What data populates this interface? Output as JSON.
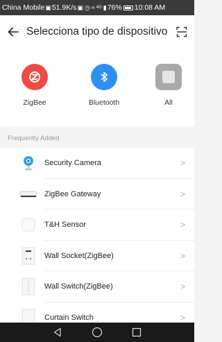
{
  "status_bar": {
    "carrier": "China Mobile",
    "net_speed": "51.9K/s",
    "signal": "4G",
    "battery": "76%",
    "time": "10:08 AM"
  },
  "header": {
    "title": "Selecciona tipo de dispositivo"
  },
  "categories": [
    {
      "label": "ZigBee",
      "color": "#ef4a44",
      "icon": "zigbee-icon"
    },
    {
      "label": "Bluetooth",
      "color": "#2e8ff0",
      "icon": "bluetooth-icon"
    },
    {
      "label": "All",
      "color": "#a9a9a9",
      "icon": "all-devices-icon"
    }
  ],
  "section": {
    "label": "Frequently Added"
  },
  "devices": [
    {
      "label": "Security Camera",
      "icon": "camera-icon"
    },
    {
      "label": "ZigBee Gateway",
      "icon": "gateway-icon"
    },
    {
      "label": "T&H Sensor",
      "icon": "sensor-icon"
    },
    {
      "label": "Wall Socket(ZigBee)",
      "icon": "wall-socket-icon"
    },
    {
      "label": "Wall Switch(ZigBee)",
      "icon": "wall-switch-icon"
    },
    {
      "label": "Curtain Switch",
      "icon": "curtain-switch-icon"
    }
  ]
}
